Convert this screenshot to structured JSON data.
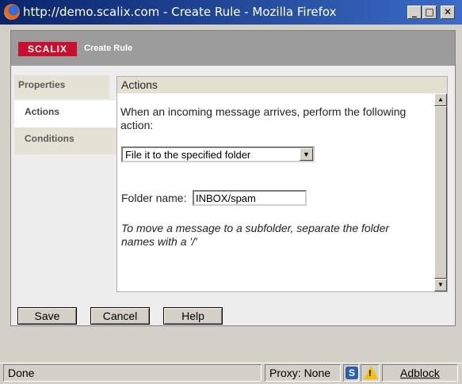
{
  "window": {
    "title": "http://demo.scalix.com - Create Rule - Mozilla Firefox",
    "minimize": "_",
    "maximize": "□",
    "close": "✕"
  },
  "header": {
    "logo": "SCALIX",
    "title": "Create Rule",
    "logo_color": "#c8102e"
  },
  "nav": {
    "properties": "Properties",
    "actions": "Actions",
    "conditions": "Conditions"
  },
  "pane": {
    "heading": "Actions",
    "intro": "When an incoming message arrives, perform the following action:",
    "action_select": {
      "selected": "File it to the specified folder"
    },
    "folder_label": "Folder name:",
    "folder_value": "INBOX/spam",
    "hint": "To move a message to a subfolder, separate the folder names with a '/'"
  },
  "buttons": {
    "save": "Save",
    "cancel": "Cancel",
    "help": "Help"
  },
  "status": {
    "done": "Done",
    "proxy": "Proxy: None",
    "s_icon": "S",
    "adblock": "Adblock"
  }
}
